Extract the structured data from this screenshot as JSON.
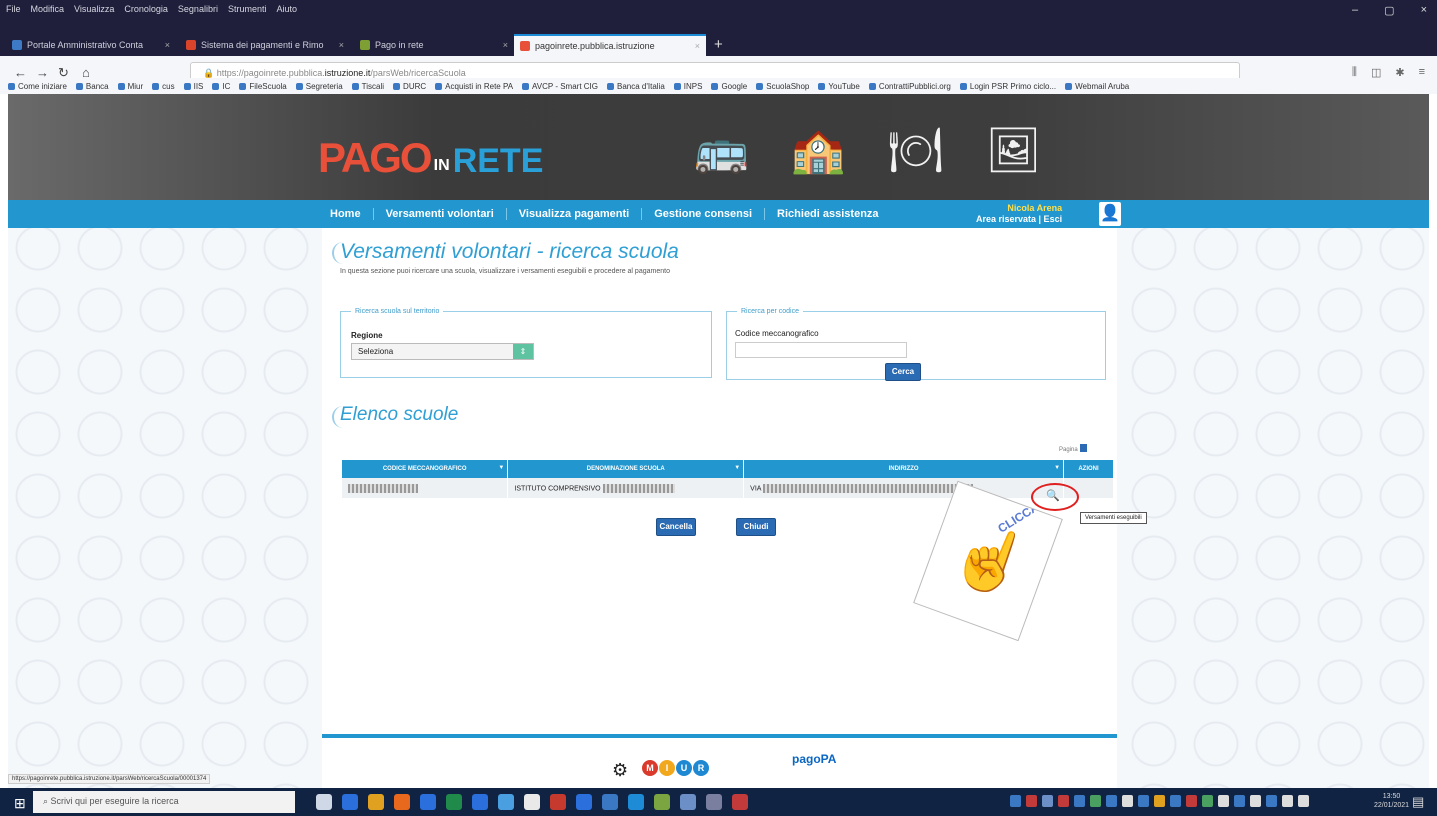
{
  "browser": {
    "menu": [
      "File",
      "Modifica",
      "Visualizza",
      "Cronologia",
      "Segnalibri",
      "Strumenti",
      "Aiuto"
    ],
    "window_controls": [
      "–",
      "▢",
      "×"
    ],
    "tabs": [
      {
        "label": "Portale Amministrativo Conta",
        "color": "#3d7bc7"
      },
      {
        "label": "Sistema dei pagamenti e Rimo",
        "color": "#d9442b"
      },
      {
        "label": "Pago in rete",
        "color": "#7d9f33"
      },
      {
        "label": "pagoinrete.pubblica.istruzione",
        "color": "#e8503a"
      }
    ],
    "new_tab": "+",
    "url_prefix": "https://pagoinrete.pubblica.",
    "url_domain": "istruzione.it",
    "url_path": "/parsWeb/ricercaScuola",
    "bookmarks": [
      "Come iniziare",
      "Banca",
      "Miur",
      "cus",
      "IIS",
      "IC",
      "FileScuola",
      "Segreteria",
      "Tiscali",
      "DURC",
      "Acquisti in Rete PA",
      "AVCP - Smart CIG",
      "Banca d'Italia",
      "INPS",
      "Google",
      "ScuolaShop",
      "YouTube",
      "ContrattiPubblici.org",
      "Login PSR Primo ciclo...",
      "Webmail Aruba"
    ]
  },
  "site": {
    "logo": {
      "pago": "PAGO",
      "in": "IN",
      "rete": "RETE"
    },
    "nav": [
      "Home",
      "Versamenti volontari",
      "Visualizza pagamenti",
      "Gestione consensi",
      "Richiedi assistenza"
    ],
    "user_name": "Nicola Arena",
    "user_links": "Area riservata | Esci"
  },
  "page": {
    "title": "Versamenti volontari - ricerca scuola",
    "intro": "In questa sezione puoi ricercare una scuola, visualizzare i versamenti eseguibili e procedere al pagamento",
    "territory_legend": "Ricerca scuola sul territorio",
    "region_label": "Regione",
    "region_value": "Seleziona",
    "code_legend": "Ricerca per codice",
    "code_label": "Codice meccanografico",
    "code_value": "",
    "search_button": "Cerca",
    "list_title": "Elenco scuole",
    "pager_label": "Pagina",
    "table_headers": [
      "CODICE MECCANOGRAFICO",
      "DENOMINAZIONE SCUOLA",
      "INDIRIZZO",
      "AZIONI"
    ],
    "row_school_prefix": "ISTITUTO COMPRENSIVO",
    "row_address_prefix": "VIA",
    "cancel_button": "Cancella",
    "close_button": "Chiudi",
    "tooltip": "Versamenti eseguibili",
    "callout": "CLICCA"
  },
  "status_url": "https://pagoinrete.pubblica.istruzione.it/parsWeb/ricercaScuola/00001374",
  "taskbar": {
    "search_placeholder": "Scrivi qui per eseguire la ricerca",
    "time": "13:50",
    "date": "22/01/2021"
  }
}
